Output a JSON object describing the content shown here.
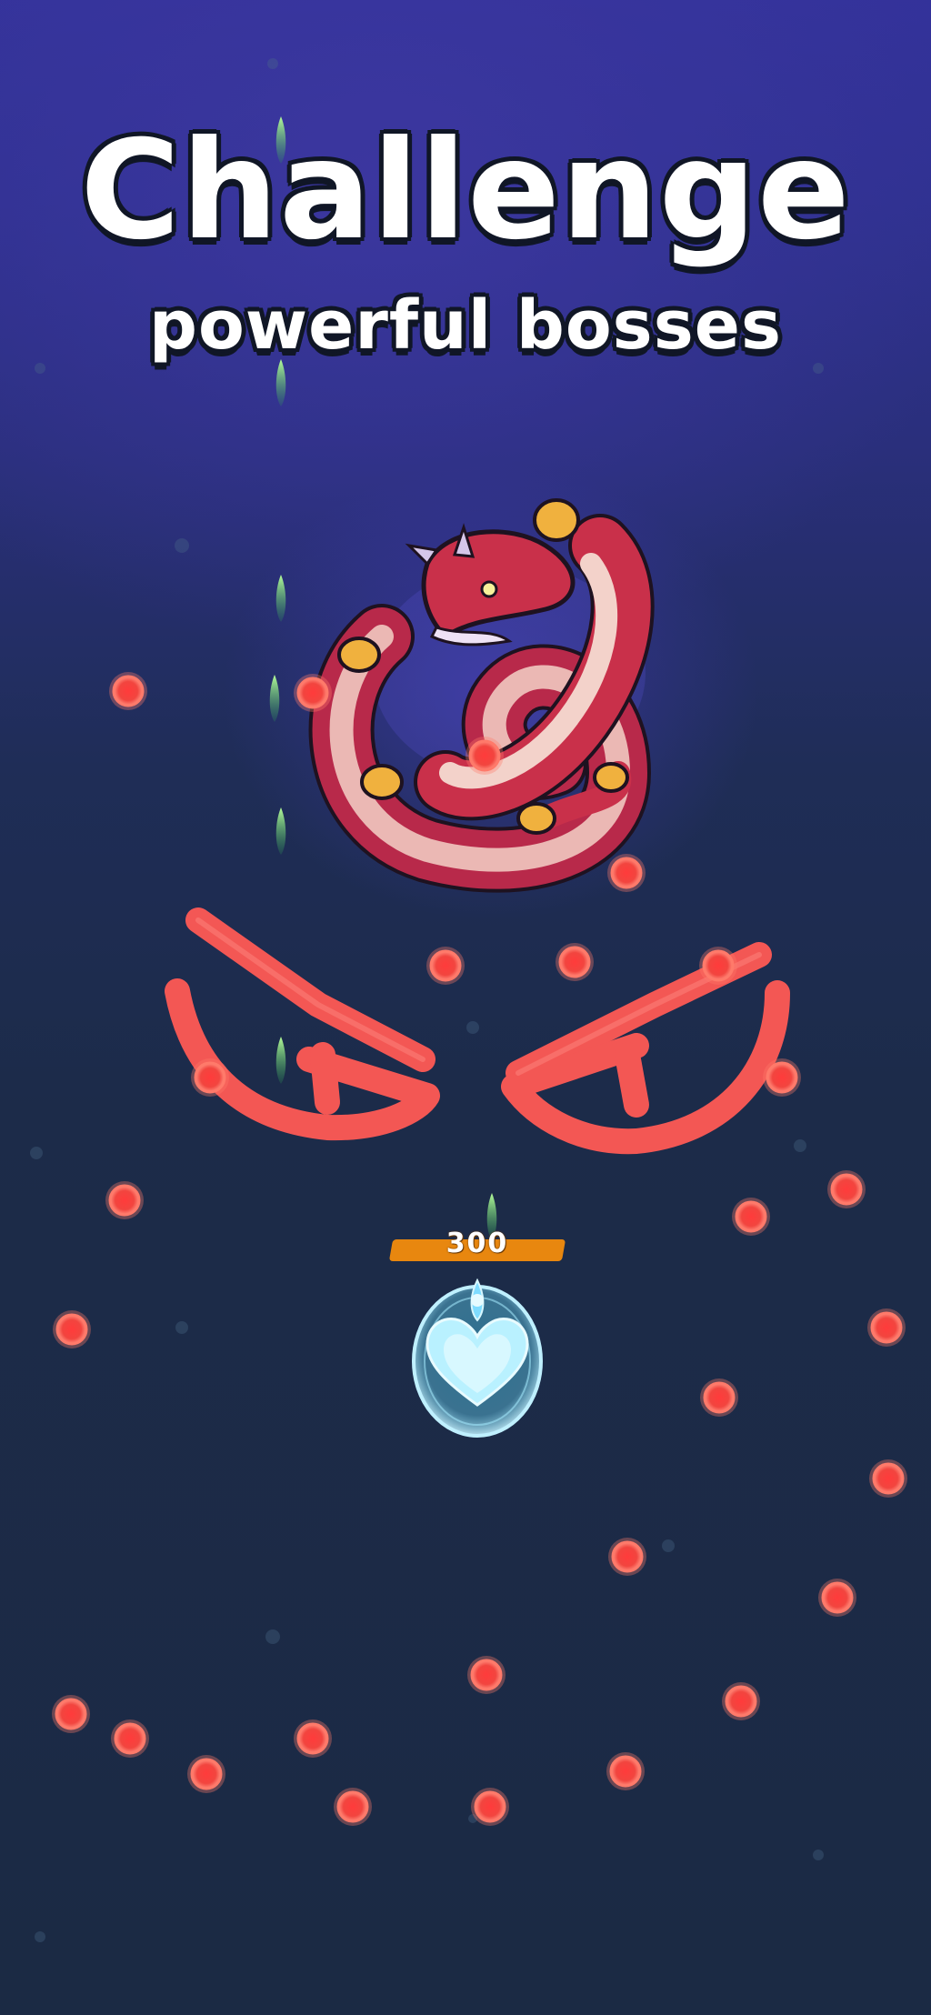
{
  "title": {
    "main": "Challenge",
    "sub": "powerful bosses"
  },
  "player": {
    "score": "300",
    "icon": "heart-ship-icon",
    "shield_color": "#8fe6ff"
  },
  "boss": {
    "icon": "serpent-dragon-icon",
    "body_color": "#c9304a",
    "belly_color": "#f3c9c3"
  },
  "colors": {
    "bullet": "#ff4f4f",
    "bullet_glow": "#ff7a6a",
    "player_shot": "#3fd06a",
    "score_bar": "#e8870f",
    "angry_eyes": "#ff5a55"
  }
}
